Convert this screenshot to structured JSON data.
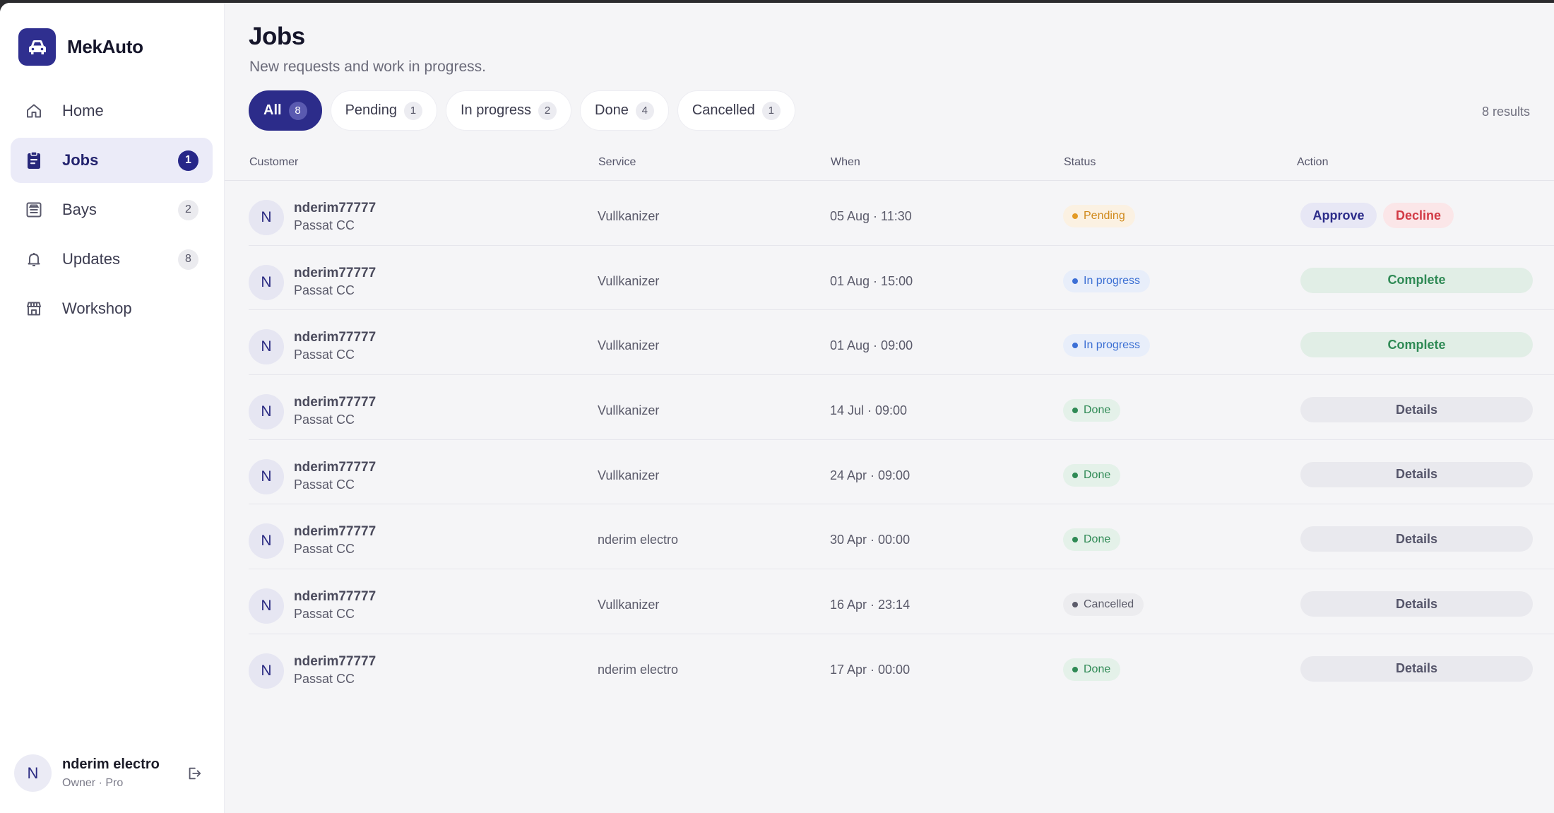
{
  "brand": {
    "name": "MekAuto",
    "icon": "car-icon"
  },
  "nav": [
    {
      "key": "home",
      "label": "Home",
      "icon": "home-icon",
      "badge": ""
    },
    {
      "key": "jobs",
      "label": "Jobs",
      "icon": "clipboard-icon",
      "badge": "1",
      "active": true
    },
    {
      "key": "bays",
      "label": "Bays",
      "icon": "bay-icon",
      "badge": "2"
    },
    {
      "key": "updates",
      "label": "Updates",
      "icon": "bell-icon",
      "badge": "8"
    },
    {
      "key": "workshop",
      "label": "Workshop",
      "icon": "store-icon",
      "badge": ""
    }
  ],
  "user": {
    "initial": "N",
    "name": "nderim electro",
    "role": "Owner · Pro"
  },
  "page": {
    "title": "Jobs",
    "subtitle": "New requests and work in progress.",
    "results": "8 results"
  },
  "filters": [
    {
      "label": "All",
      "count": "8",
      "active": true
    },
    {
      "label": "Pending",
      "count": "1"
    },
    {
      "label": "In progress",
      "count": "2"
    },
    {
      "label": "Done",
      "count": "4"
    },
    {
      "label": "Cancelled",
      "count": "1"
    }
  ],
  "columns": {
    "customer": "Customer",
    "service": "Service",
    "when": "When",
    "status": "Status",
    "action": "Action"
  },
  "rows": [
    {
      "initial": "N",
      "customer": "nderim77777",
      "car": "Passat CC",
      "service": "Vullkanizer",
      "when": "05 Aug · 11:30",
      "status": "Pending",
      "status_kind": "pending",
      "actions": [
        "Approve",
        "Decline"
      ]
    },
    {
      "initial": "N",
      "customer": "nderim77777",
      "car": "Passat CC",
      "service": "Vullkanizer",
      "when": "01 Aug · 15:00",
      "status": "In progress",
      "status_kind": "progress",
      "actions": [
        "Complete"
      ]
    },
    {
      "initial": "N",
      "customer": "nderim77777",
      "car": "Passat CC",
      "service": "Vullkanizer",
      "when": "01 Aug · 09:00",
      "status": "In progress",
      "status_kind": "progress",
      "actions": [
        "Complete"
      ]
    },
    {
      "initial": "N",
      "customer": "nderim77777",
      "car": "Passat CC",
      "service": "Vullkanizer",
      "when": "14 Jul · 09:00",
      "status": "Done",
      "status_kind": "done",
      "actions": [
        "Details"
      ]
    },
    {
      "initial": "N",
      "customer": "nderim77777",
      "car": "Passat CC",
      "service": "Vullkanizer",
      "when": "24 Apr · 09:00",
      "status": "Done",
      "status_kind": "done",
      "actions": [
        "Details"
      ]
    },
    {
      "initial": "N",
      "customer": "nderim77777",
      "car": "Passat CC",
      "service": "nderim electro",
      "when": "30 Apr · 00:00",
      "status": "Done",
      "status_kind": "done",
      "actions": [
        "Details"
      ]
    },
    {
      "initial": "N",
      "customer": "nderim77777",
      "car": "Passat CC",
      "service": "Vullkanizer",
      "when": "16 Apr · 23:14",
      "status": "Cancelled",
      "status_kind": "cancelled",
      "actions": [
        "Details"
      ]
    },
    {
      "initial": "N",
      "customer": "nderim77777",
      "car": "Passat CC",
      "service": "nderim electro",
      "when": "17 Apr · 00:00",
      "status": "Done",
      "status_kind": "done",
      "actions": [
        "Details"
      ]
    }
  ],
  "colors": {
    "accent": "#2c2c8a",
    "pending": "#e39a24",
    "progress": "#3c6fd6",
    "done": "#2f8a55",
    "decline": "#d23a45"
  }
}
